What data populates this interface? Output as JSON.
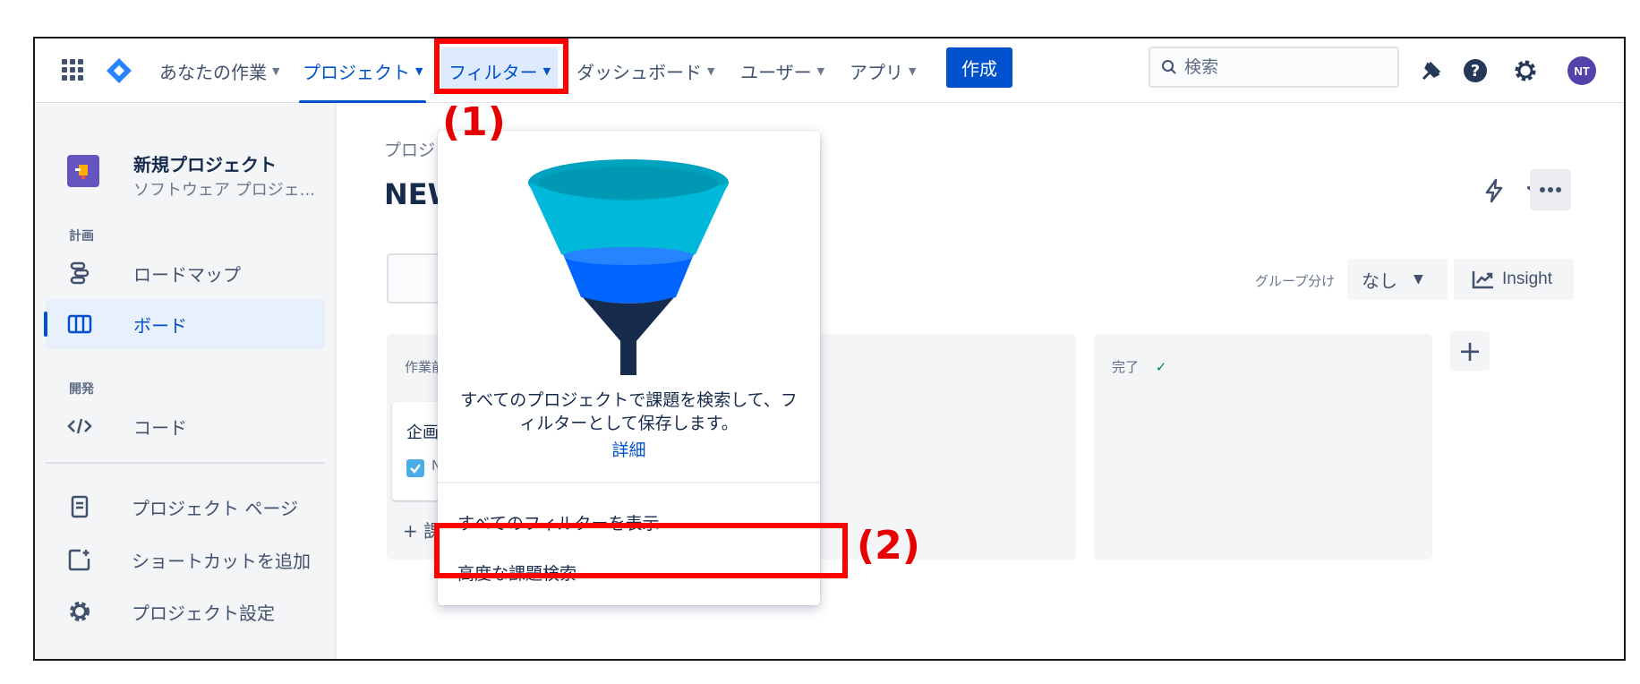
{
  "topnav": {
    "items": [
      {
        "label": "あなたの作業"
      },
      {
        "label": "プロジェクト"
      },
      {
        "label": "フィルター"
      },
      {
        "label": "ダッシュボード"
      },
      {
        "label": "ユーザー"
      },
      {
        "label": "アプリ"
      }
    ],
    "create_label": "作成",
    "search_placeholder": "検索",
    "avatar_initials": "NT"
  },
  "sidebar": {
    "project_name": "新規プロジェクト",
    "project_type": "ソフトウェア プロジェ...",
    "sections": [
      {
        "heading": "計画",
        "items": [
          {
            "label": "ロードマップ"
          },
          {
            "label": "ボード"
          }
        ]
      },
      {
        "heading": "開発",
        "items": [
          {
            "label": "コード"
          }
        ]
      }
    ],
    "bottom_items": [
      {
        "label": "プロジェクト ページ"
      },
      {
        "label": "ショートカットを追加"
      },
      {
        "label": "プロジェクト設定"
      }
    ]
  },
  "main": {
    "breadcrumb": "プロジ",
    "title": "NEW",
    "groupby_label": "グループ分け",
    "groupby_value": "なし",
    "insight_label": "Insight",
    "columns": [
      {
        "title": "作業前",
        "card_title": "企画",
        "card_key": "N",
        "create_label": "+ 課"
      },
      {
        "title": "完了"
      }
    ],
    "add_column_symbol": "+"
  },
  "filter_dropdown": {
    "description": "すべてのプロジェクトで課題を検索して、フィルターとして保存します。",
    "details_link": "詳細",
    "items": [
      {
        "label": "すべてのフィルターを表示"
      },
      {
        "label": "高度な課題検索"
      }
    ]
  },
  "annotations": {
    "label_1": "(1)",
    "label_2": "(2)",
    "color": "#ff0000"
  },
  "colors": {
    "brand": "#0052cc",
    "sidebar_bg": "#f4f5f7",
    "selected_bg": "#e8f0fc"
  }
}
